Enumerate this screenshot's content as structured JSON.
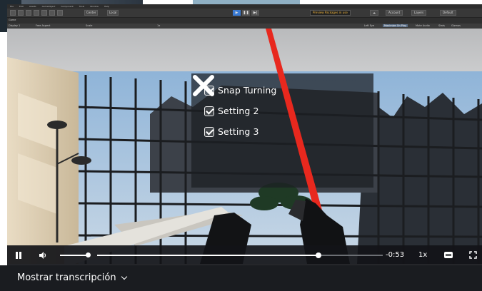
{
  "editor": {
    "menu": [
      "File",
      "Edit",
      "Assets",
      "GameObject",
      "Component",
      "Tools",
      "Window",
      "Help"
    ],
    "toolbar": {
      "center_label": "Center",
      "local_label": "Local",
      "play_buttons": [
        "play-icon",
        "pause-icon",
        "step-icon"
      ],
      "warning_text": "Preview Packages in use",
      "account_label": "Account",
      "layers_label": "Layers",
      "layout_label": "Default"
    },
    "scene": {
      "tab_label": "Game",
      "display_label": "Display 1",
      "aspect_label": "Free Aspect",
      "scale_label": "Scale",
      "scale_value": "1x",
      "right_items": [
        "Left Eye",
        "Maximize On Play",
        "Mute Audio",
        "Stats",
        "Gizmos"
      ]
    }
  },
  "vr_menu": {
    "settings": [
      {
        "label": "Snap Turning",
        "checked": true
      },
      {
        "label": "Setting 2",
        "checked": true
      },
      {
        "label": "Setting 3",
        "checked": true
      }
    ],
    "close_icon": "close-x-icon",
    "laser_color": "#e8281e"
  },
  "player": {
    "time_remaining": "-0:53",
    "speed": "1x",
    "progress": 0.776,
    "volume": 0.9,
    "icons": [
      "pause-icon",
      "volume-icon",
      "captions-icon",
      "fullscreen-icon"
    ]
  },
  "transcript": {
    "label": "Mostrar transcripción"
  },
  "colors": {
    "accent": "#3b7bd4",
    "warning": "#f0b43c",
    "control_bg": "#121418"
  }
}
